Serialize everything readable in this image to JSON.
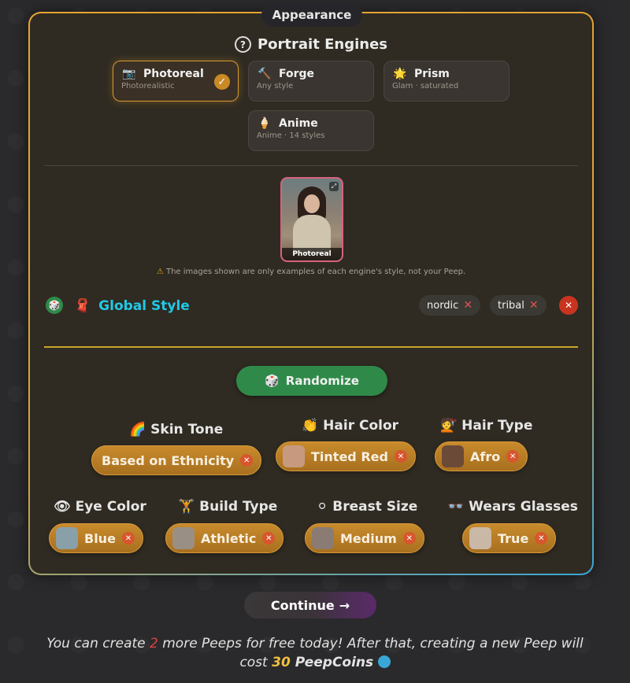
{
  "panel": {
    "title": "Appearance"
  },
  "engines": {
    "title": "Portrait Engines",
    "help_icon": "?",
    "items": [
      {
        "name": "Photoreal",
        "sub": "Photorealistic",
        "icon": "📷",
        "selected": true
      },
      {
        "name": "Forge",
        "sub": "Any style",
        "icon": "🔨",
        "selected": false
      },
      {
        "name": "Prism",
        "sub": "Glam · saturated",
        "icon": "🌟",
        "selected": false
      },
      {
        "name": "Anime",
        "sub": "Anime · 14 styles",
        "icon": "🍦",
        "selected": false
      }
    ],
    "check_icon": "✓"
  },
  "preview": {
    "label": "Photoreal",
    "expand_icon": "⤢"
  },
  "disclaimer": {
    "warn_icon": "⚠",
    "text": "The images shown are only examples of each engine's style, not your Peep."
  },
  "global_style": {
    "title": "Global Style",
    "dice_icon": "🎲",
    "style_icon": "🧣",
    "tags": [
      "nordic",
      "tribal"
    ],
    "remove_icon": "✕",
    "clear_icon": "✕"
  },
  "randomize": {
    "label": "Randomize",
    "icon": "🎲"
  },
  "attributes": [
    {
      "label": "Skin Tone",
      "icon": "🌈",
      "value": "Based on Ethnicity",
      "has_thumb": false
    },
    {
      "label": "Hair Color",
      "icon": "👏",
      "value": "Tinted Red",
      "has_thumb": true
    },
    {
      "label": "Hair Type",
      "icon": "💇",
      "value": "Afro",
      "has_thumb": true
    },
    {
      "label": "Eye Color",
      "icon": "👁",
      "value": "Blue",
      "has_thumb": true
    },
    {
      "label": "Build Type",
      "icon": "🏋",
      "value": "Athletic",
      "has_thumb": true
    },
    {
      "label": "Breast Size",
      "icon": "⚪",
      "value": "Medium",
      "has_thumb": true
    },
    {
      "label": "Wears Glasses",
      "icon": "👓",
      "value": "True",
      "has_thumb": true
    }
  ],
  "remove_chip_icon": "✕",
  "continue": {
    "label": "Continue",
    "arrow": "→"
  },
  "footer": {
    "part1": "You can create ",
    "count": "2",
    "part2": " more Peeps for free today! After that, creating a new Peep will",
    "part3": "cost ",
    "cost": "30",
    "currency": " PeepCoins"
  },
  "colors": {
    "accent_gold": "#d89a2f",
    "accent_cyan": "#20c9e6",
    "randomize_green": "#2f8a49"
  }
}
